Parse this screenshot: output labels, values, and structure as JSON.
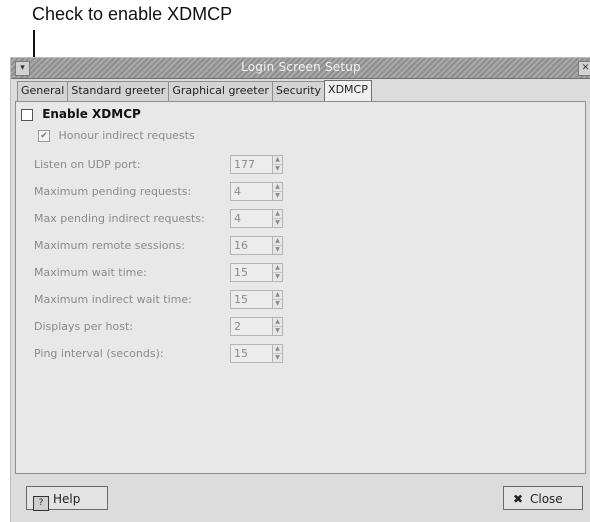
{
  "annotation": {
    "text": "Check to enable XDMCP"
  },
  "window": {
    "title": "Login Screen Setup",
    "menu_glyph": "▾",
    "close_glyph": "✕"
  },
  "tabs": [
    {
      "label": "General",
      "active": false
    },
    {
      "label": "Standard greeter",
      "active": false
    },
    {
      "label": "Graphical greeter",
      "active": false
    },
    {
      "label": "Security",
      "active": false
    },
    {
      "label": "XDMCP",
      "active": true
    }
  ],
  "xdmcp": {
    "enable_label": "Enable XDMCP",
    "enable_checked": false,
    "honour_label": "Honour indirect requests",
    "honour_checked": true,
    "fields": [
      {
        "label": "Listen on UDP port:",
        "value": "177"
      },
      {
        "label": "Maximum pending requests:",
        "value": "4"
      },
      {
        "label": "Max pending indirect requests:",
        "value": "4"
      },
      {
        "label": "Maximum remote sessions:",
        "value": "16"
      },
      {
        "label": "Maximum wait time:",
        "value": "15"
      },
      {
        "label": "Maximum indirect wait time:",
        "value": "15"
      },
      {
        "label": "Displays per host:",
        "value": "2"
      },
      {
        "label": "Ping interval (seconds):",
        "value": "15"
      }
    ]
  },
  "buttons": {
    "help_label": "Help",
    "close_label": "Close",
    "close_glyph": "✖"
  }
}
